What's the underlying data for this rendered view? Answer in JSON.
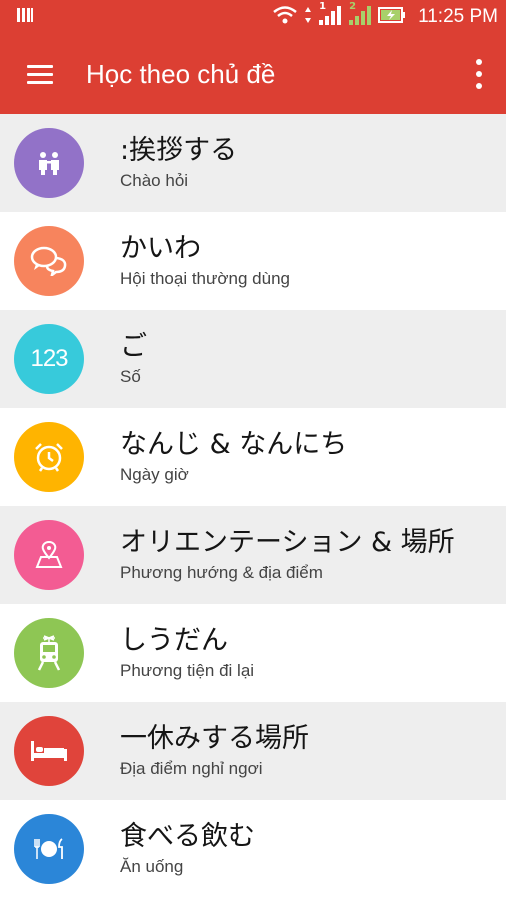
{
  "status_bar": {
    "time": "11:25 PM",
    "sim1_label": "1",
    "sim2_label": "2"
  },
  "app_bar": {
    "title": "Học theo chủ đề"
  },
  "topics": [
    {
      "title": ":挨拶する",
      "subtitle": "Chào hỏi",
      "color": "#9272c8",
      "icon": "people-icon"
    },
    {
      "title": "かいわ",
      "subtitle": "Hội thoại thường dùng",
      "color": "#f7845d",
      "icon": "chat-bubbles-icon"
    },
    {
      "title": "ご",
      "subtitle": "Số",
      "color": "#37cadb",
      "icon_text": "123",
      "icon": "numbers-icon"
    },
    {
      "title": "なんじ  & なんにち",
      "subtitle": "Ngày giờ",
      "color": "#ffb400",
      "icon": "alarm-clock-icon"
    },
    {
      "title": "オリエンテーション & 場所",
      "subtitle": "Phương hướng & địa điểm",
      "color": "#f35c93",
      "icon": "map-pin-icon"
    },
    {
      "title": "しうだん",
      "subtitle": "Phương tiện đi lại",
      "color": "#8ec654",
      "icon": "train-icon"
    },
    {
      "title": "一休みする場所",
      "subtitle": "Địa điểm nghỉ ngơi",
      "color": "#e0443b",
      "icon": "bed-icon"
    },
    {
      "title": "食べる飲む",
      "subtitle": "Ăn uống",
      "color": "#2b86d8",
      "icon": "plate-cutlery-icon"
    }
  ],
  "colors": {
    "primary": "#dc3f33",
    "row_shaded": "#eeeeee",
    "row_plain": "#ffffff"
  }
}
